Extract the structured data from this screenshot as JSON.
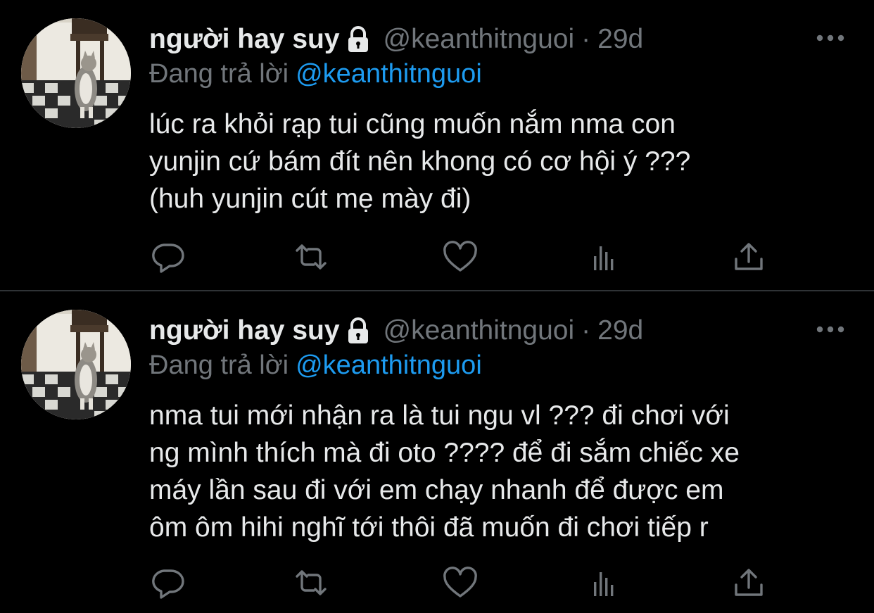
{
  "tweets": [
    {
      "name": "người hay suy",
      "handle": "@keanthitnguoi",
      "separator": "·",
      "time": "29d",
      "reply_prefix": "Đang trả lời",
      "reply_to": "@keanthitnguoi",
      "lines": [
        "lúc ra khỏi rạp tui cũng muốn nắm nma con",
        "yunjin cứ bám đít nên khong có cơ hội ý ???",
        "(huh yunjin cút mẹ mày đi)"
      ],
      "icons": {
        "lock": "lock-icon",
        "more": "more-icon",
        "reply": "reply-icon",
        "retweet": "retweet-icon",
        "like": "heart-icon",
        "views": "views-icon",
        "share": "share-icon"
      }
    },
    {
      "name": "người hay suy",
      "handle": "@keanthitnguoi",
      "separator": "·",
      "time": "29d",
      "reply_prefix": "Đang trả lời",
      "reply_to": "@keanthitnguoi",
      "lines": [
        "nma tui mới nhận ra là tui ngu vl ??? đi chơi với",
        "ng mình thích mà đi oto ???? để đi sắm chiếc xe",
        "máy lần sau đi với em chạy nhanh để được em",
        "ôm ôm hihi nghĩ tới thôi đã muốn đi chơi tiếp r"
      ],
      "icons": {
        "lock": "lock-icon",
        "more": "more-icon",
        "reply": "reply-icon",
        "retweet": "retweet-icon",
        "like": "heart-icon",
        "views": "views-icon",
        "share": "share-icon"
      }
    }
  ],
  "colors": {
    "background": "#000000",
    "text": "#e7e9ea",
    "secondary": "#71767b",
    "link": "#1d9bf0",
    "divider": "#2f3336"
  }
}
